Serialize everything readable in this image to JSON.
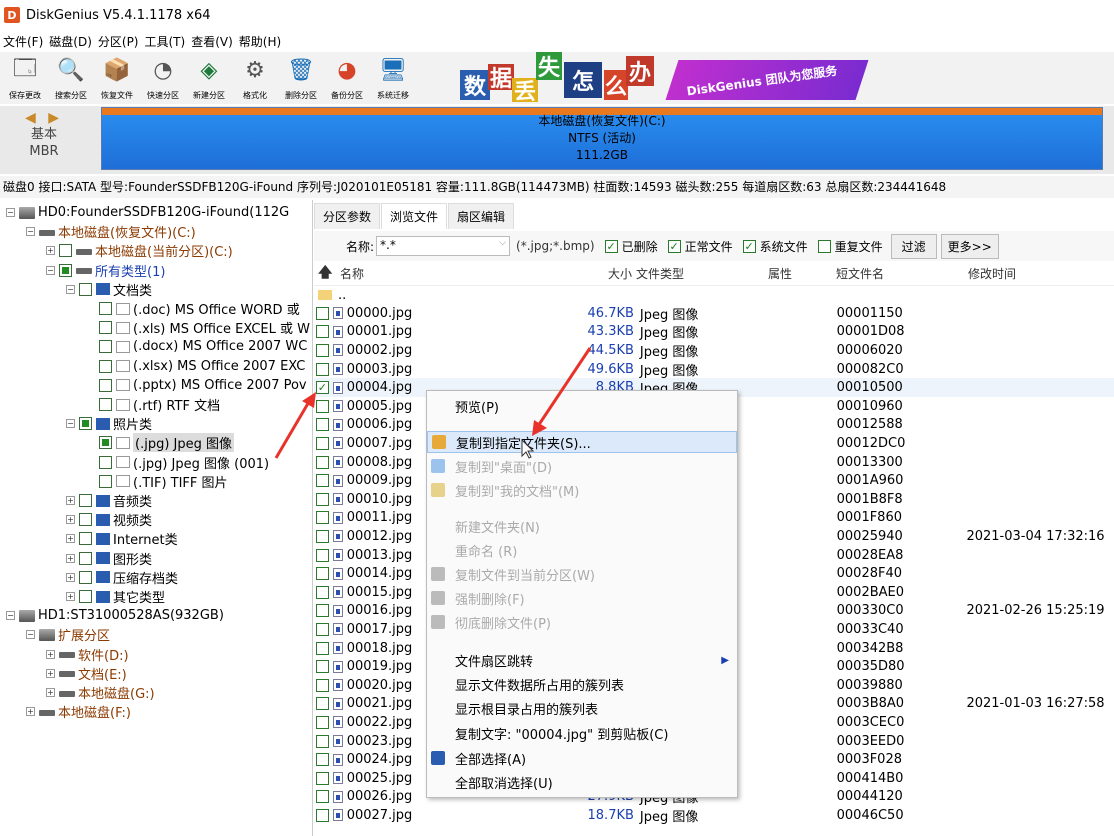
{
  "app": {
    "logo": "D",
    "title": "DiskGenius V5.4.1.1178 x64"
  },
  "menu": [
    "文件(F)",
    "磁盘(D)",
    "分区(P)",
    "工具(T)",
    "查看(V)",
    "帮助(H)"
  ],
  "toolbar": [
    {
      "label": "保存更改",
      "icon": "save-icon"
    },
    {
      "label": "搜索分区",
      "icon": "search-icon"
    },
    {
      "label": "恢复文件",
      "icon": "recover-icon"
    },
    {
      "label": "快速分区",
      "icon": "quick-partition-icon"
    },
    {
      "label": "新建分区",
      "icon": "new-partition-icon"
    },
    {
      "label": "格式化",
      "icon": "format-icon"
    },
    {
      "label": "删除分区",
      "icon": "trash-icon"
    },
    {
      "label": "备份分区",
      "icon": "backup-icon"
    },
    {
      "label": "系统迁移",
      "icon": "migrate-icon"
    }
  ],
  "banner": {
    "chars": [
      "数",
      "据",
      "丢",
      "失",
      "怎",
      "么",
      "办"
    ],
    "slogan": "DiskGenius 团队为您服务"
  },
  "disk_map": {
    "arrows": "◀ ▶",
    "type1": "基本",
    "type2": "MBR",
    "part_name": "本地磁盘(恢复文件)(C:)",
    "part_fs": "NTFS (活动)",
    "part_size": "111.2GB"
  },
  "disk_info": "磁盘0 接口:SATA  型号:FounderSSDFB120G-iFound  序列号:J020101E05181  容量:111.8GB(114473MB)  柱面数:14593  磁头数:255  每道扇区数:63  总扇区数:234441648",
  "tree": [
    {
      "label": "HD0:FounderSSDFB120G-iFound(112G",
      "indent": 0,
      "exp": "−",
      "cb": false,
      "icon": "disk",
      "cls": ""
    },
    {
      "label": "本地磁盘(恢复文件)(C:)",
      "indent": 1,
      "exp": "−",
      "cb": false,
      "icon": "part",
      "cls": "t-part"
    },
    {
      "label": "本地磁盘(当前分区)(C:)",
      "indent": 2,
      "exp": "+",
      "cb": "empty",
      "icon": "part",
      "cls": "t-part"
    },
    {
      "label": "所有类型(1)",
      "indent": 2,
      "exp": "−",
      "cb": "partial",
      "icon": "part",
      "cls": "t-blue"
    },
    {
      "label": "文档类",
      "indent": 3,
      "exp": "−",
      "cb": "empty",
      "icon": "folder",
      "cls": ""
    },
    {
      "label": "(.doc) MS Office WORD 或",
      "indent": 4,
      "exp": "",
      "cb": "empty",
      "icon": "file",
      "cls": ""
    },
    {
      "label": "(.xls) MS Office EXCEL 或 W",
      "indent": 4,
      "exp": "",
      "cb": "empty",
      "icon": "file",
      "cls": ""
    },
    {
      "label": "(.docx) MS Office 2007 WC",
      "indent": 4,
      "exp": "",
      "cb": "empty",
      "icon": "file",
      "cls": ""
    },
    {
      "label": "(.xlsx) MS Office 2007 EXC",
      "indent": 4,
      "exp": "",
      "cb": "empty",
      "icon": "file",
      "cls": ""
    },
    {
      "label": "(.pptx) MS Office 2007 Pov",
      "indent": 4,
      "exp": "",
      "cb": "empty",
      "icon": "file",
      "cls": ""
    },
    {
      "label": "(.rtf) RTF 文档",
      "indent": 4,
      "exp": "",
      "cb": "empty",
      "icon": "file",
      "cls": ""
    },
    {
      "label": "照片类",
      "indent": 3,
      "exp": "−",
      "cb": "partial",
      "icon": "folder",
      "cls": ""
    },
    {
      "label": "(.jpg) Jpeg 图像",
      "indent": 4,
      "exp": "",
      "cb": "partial",
      "icon": "file",
      "cls": "sel"
    },
    {
      "label": "(.jpg) Jpeg 图像 (001)",
      "indent": 4,
      "exp": "",
      "cb": "empty",
      "icon": "file",
      "cls": ""
    },
    {
      "label": "(.TIF) TIFF 图片",
      "indent": 4,
      "exp": "",
      "cb": "empty",
      "icon": "file",
      "cls": ""
    },
    {
      "label": "音频类",
      "indent": 3,
      "exp": "+",
      "cb": "empty",
      "icon": "folder",
      "cls": ""
    },
    {
      "label": "视频类",
      "indent": 3,
      "exp": "+",
      "cb": "empty",
      "icon": "folder",
      "cls": ""
    },
    {
      "label": "Internet类",
      "indent": 3,
      "exp": "+",
      "cb": "empty",
      "icon": "folder",
      "cls": ""
    },
    {
      "label": "图形类",
      "indent": 3,
      "exp": "+",
      "cb": "empty",
      "icon": "folder",
      "cls": ""
    },
    {
      "label": "压缩存档类",
      "indent": 3,
      "exp": "+",
      "cb": "empty",
      "icon": "folder",
      "cls": ""
    },
    {
      "label": "其它类型",
      "indent": 3,
      "exp": "+",
      "cb": "empty",
      "icon": "folder",
      "cls": ""
    },
    {
      "label": "HD1:ST31000528AS(932GB)",
      "indent": 0,
      "exp": "−",
      "cb": false,
      "icon": "disk",
      "cls": ""
    },
    {
      "label": "扩展分区",
      "indent": 1,
      "exp": "−",
      "cb": false,
      "icon": "disk",
      "cls": "t-part"
    },
    {
      "label": "软件(D:)",
      "indent": 2,
      "exp": "+",
      "cb": false,
      "icon": "part",
      "cls": "t-part"
    },
    {
      "label": "文档(E:)",
      "indent": 2,
      "exp": "+",
      "cb": false,
      "icon": "part",
      "cls": "t-part"
    },
    {
      "label": "本地磁盘(G:)",
      "indent": 2,
      "exp": "+",
      "cb": false,
      "icon": "part",
      "cls": "t-part"
    },
    {
      "label": "本地磁盘(F:)",
      "indent": 1,
      "exp": "+",
      "cb": false,
      "icon": "part",
      "cls": "t-part"
    }
  ],
  "tabs": [
    "分区参数",
    "浏览文件",
    "扇区编辑"
  ],
  "filter": {
    "name_label": "名称:",
    "name_value": "*.*",
    "hint": "(*.jpg;*.bmp)",
    "checks": [
      {
        "label": "已删除",
        "on": true
      },
      {
        "label": "正常文件",
        "on": true
      },
      {
        "label": "系统文件",
        "on": true
      },
      {
        "label": "重复文件",
        "on": false
      }
    ],
    "filter_btn": "过滤",
    "more_btn": "更多>>"
  },
  "columns": {
    "name": "名称",
    "size": "大小",
    "type": "文件类型",
    "attr": "属性",
    "short": "短文件名",
    "time": "修改时间"
  },
  "parent_row": "..",
  "files": [
    {
      "name": "00000.jpg",
      "size": "46.7KB",
      "type": "Jpeg 图像",
      "short": "00001150",
      "time": "",
      "on": false
    },
    {
      "name": "00001.jpg",
      "size": "43.3KB",
      "type": "Jpeg 图像",
      "short": "00001D08",
      "time": "",
      "on": false
    },
    {
      "name": "00002.jpg",
      "size": "44.5KB",
      "type": "Jpeg 图像",
      "short": "00006020",
      "time": "",
      "on": false
    },
    {
      "name": "00003.jpg",
      "size": "49.6KB",
      "type": "Jpeg 图像",
      "short": "000082C0",
      "time": "",
      "on": false
    },
    {
      "name": "00004.jpg",
      "size": "8.8KB",
      "type": "Jpeg 图像",
      "short": "00010500",
      "time": "",
      "on": true
    },
    {
      "name": "00005.jpg",
      "size": "",
      "type": "",
      "short": "00010960",
      "time": "",
      "on": false
    },
    {
      "name": "00006.jpg",
      "size": "",
      "type": "",
      "short": "00012588",
      "time": "",
      "on": false
    },
    {
      "name": "00007.jpg",
      "size": "",
      "type": "",
      "short": "00012DC0",
      "time": "",
      "on": false
    },
    {
      "name": "00008.jpg",
      "size": "",
      "type": "",
      "short": "00013300",
      "time": "",
      "on": false
    },
    {
      "name": "00009.jpg",
      "size": "",
      "type": "",
      "short": "0001A960",
      "time": "",
      "on": false
    },
    {
      "name": "00010.jpg",
      "size": "",
      "type": "",
      "short": "0001B8F8",
      "time": "",
      "on": false
    },
    {
      "name": "00011.jpg",
      "size": "",
      "type": "",
      "short": "0001F860",
      "time": "",
      "on": false
    },
    {
      "name": "00012.jpg",
      "size": "",
      "type": "",
      "short": "00025940",
      "time": "2021-03-04 17:32:16",
      "on": false
    },
    {
      "name": "00013.jpg",
      "size": "",
      "type": "",
      "short": "00028EA8",
      "time": "",
      "on": false
    },
    {
      "name": "00014.jpg",
      "size": "",
      "type": "",
      "short": "00028F40",
      "time": "",
      "on": false
    },
    {
      "name": "00015.jpg",
      "size": "",
      "type": "",
      "short": "0002BAE0",
      "time": "",
      "on": false
    },
    {
      "name": "00016.jpg",
      "size": "",
      "type": "",
      "short": "000330C0",
      "time": "2021-02-26 15:25:19",
      "on": false
    },
    {
      "name": "00017.jpg",
      "size": "",
      "type": "",
      "short": "00033C40",
      "time": "",
      "on": false
    },
    {
      "name": "00018.jpg",
      "size": "",
      "type": "",
      "short": "000342B8",
      "time": "",
      "on": false
    },
    {
      "name": "00019.jpg",
      "size": "",
      "type": "",
      "short": "00035D80",
      "time": "",
      "on": false
    },
    {
      "name": "00020.jpg",
      "size": "",
      "type": "",
      "short": "00039880",
      "time": "",
      "on": false
    },
    {
      "name": "00021.jpg",
      "size": "",
      "type": "",
      "short": "0003B8A0",
      "time": "2021-01-03 16:27:58",
      "on": false
    },
    {
      "name": "00022.jpg",
      "size": "",
      "type": "",
      "short": "0003CEC0",
      "time": "",
      "on": false
    },
    {
      "name": "00023.jpg",
      "size": "",
      "type": "",
      "short": "0003EED0",
      "time": "",
      "on": false
    },
    {
      "name": "00024.jpg",
      "size": "",
      "type": "",
      "short": "0003F028",
      "time": "",
      "on": false
    },
    {
      "name": "00025.jpg",
      "size": "",
      "type": "",
      "short": "000414B0",
      "time": "",
      "on": false
    },
    {
      "name": "00026.jpg",
      "size": "27.9KB",
      "type": "Jpeg 图像",
      "short": "00044120",
      "time": "",
      "on": false
    },
    {
      "name": "00027.jpg",
      "size": "18.7KB",
      "type": "Jpeg 图像",
      "short": "00046C50",
      "time": "",
      "on": false
    }
  ],
  "context_menu": [
    {
      "label": "预览(P)",
      "disabled": false,
      "hl": false,
      "icon": "",
      "sub": false
    },
    {
      "label": "复制到指定文件夹(S)...",
      "disabled": false,
      "hl": true,
      "icon": "copy-folder-icon",
      "sub": false
    },
    {
      "label": "复制到\"桌面\"(D)",
      "disabled": true,
      "hl": false,
      "icon": "desktop-icon",
      "sub": false
    },
    {
      "label": "复制到\"我的文档\"(M)",
      "disabled": true,
      "hl": false,
      "icon": "documents-icon",
      "sub": false
    },
    {
      "label": "新建文件夹(N)",
      "disabled": true,
      "hl": false,
      "icon": "",
      "sub": false
    },
    {
      "label": "重命名 (R)",
      "disabled": true,
      "hl": false,
      "icon": "",
      "sub": false
    },
    {
      "label": "复制文件到当前分区(W)",
      "disabled": true,
      "hl": false,
      "icon": "copy-partition-icon",
      "sub": false
    },
    {
      "label": "强制删除(F)",
      "disabled": true,
      "hl": false,
      "icon": "force-delete-icon",
      "sub": false
    },
    {
      "label": "彻底删除文件(P)",
      "disabled": true,
      "hl": false,
      "icon": "wipe-icon",
      "sub": false
    },
    {
      "label": "文件扇区跳转",
      "disabled": false,
      "hl": false,
      "icon": "",
      "sub": true
    },
    {
      "label": "显示文件数据所占用的簇列表",
      "disabled": false,
      "hl": false,
      "icon": "",
      "sub": false
    },
    {
      "label": "显示根目录占用的簇列表",
      "disabled": false,
      "hl": false,
      "icon": "",
      "sub": false
    },
    {
      "label": "复制文字: \"00004.jpg\" 到剪贴板(C)",
      "disabled": false,
      "hl": false,
      "icon": "",
      "sub": false
    },
    {
      "label": "全部选择(A)",
      "disabled": false,
      "hl": false,
      "icon": "select-all-icon",
      "sub": false
    },
    {
      "label": "全部取消选择(U)",
      "disabled": false,
      "hl": false,
      "icon": "",
      "sub": false
    }
  ],
  "colors": {
    "accent": "#1e6fd8",
    "partition_orange": "#e8791f",
    "annotation_red": "#e8332a",
    "checkbox_green": "#1a7a1a"
  }
}
